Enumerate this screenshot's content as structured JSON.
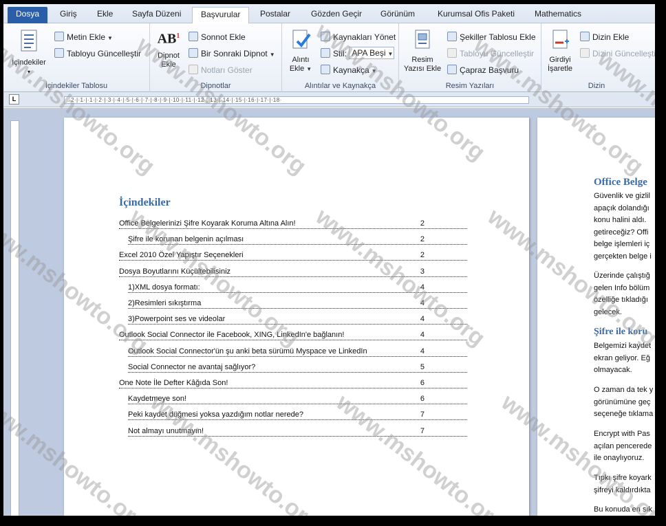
{
  "tabs": {
    "file": "Dosya",
    "items": [
      "Giriş",
      "Ekle",
      "Sayfa Düzeni",
      "Başvurular",
      "Postalar",
      "Gözden Geçir",
      "Görünüm",
      "Kurumsal Ofis Paketi",
      "Mathematics"
    ],
    "active": "Başvurular"
  },
  "ribbon": {
    "toc_group": {
      "label": "İçindekiler Tablosu",
      "toc_button": "İçindekiler",
      "add_text": "Metin Ekle",
      "update_table": "Tabloyu Güncelleştir"
    },
    "footnotes_group": {
      "label": "Dipnotlar",
      "insert_footnote_1": "Dipnot",
      "insert_footnote_2": "Ekle",
      "insert_endnote": "Sonnot Ekle",
      "next_footnote": "Bir Sonraki Dipnot",
      "show_notes": "Notları Göster"
    },
    "citations_group": {
      "label": "Alıntılar ve Kaynakça",
      "insert_citation_1": "Alıntı",
      "insert_citation_2": "Ekle",
      "manage_sources": "Kaynakları Yönet",
      "style_label": "Stil:",
      "style_value": "APA Beşi",
      "bibliography": "Kaynakça"
    },
    "captions_group": {
      "label": "Resim Yazıları",
      "insert_caption_1": "Resim",
      "insert_caption_2": "Yazısı Ekle",
      "insert_tof": "Şekiller Tablosu Ekle",
      "update_table": "Tabloyu Güncelleştir",
      "cross_ref": "Çapraz Başvuru"
    },
    "index_group": {
      "label": "Dizin",
      "mark_entry_1": "Girdiyi",
      "mark_entry_2": "İşaretle",
      "insert_index": "Dizin Ekle",
      "update_index": "Dizini Güncelleştir"
    }
  },
  "ruler": {
    "corner": "L",
    "text": "·2·|·1·|·1·|·2·|·3·|·4·|·5·|·6·|·7·|·8·|·9·|·10·|·11·|·12·|·13·|·14·|·15·|·16·|·17·|·18·"
  },
  "toc": {
    "title": "İçindekiler",
    "entries": [
      {
        "text": "Office Belgelerinizi Şifre Koyarak Koruma Altına Alın!",
        "page": "2",
        "level": 1
      },
      {
        "text": "Şifre ile korunan belgenin açılması",
        "page": "2",
        "level": 2
      },
      {
        "text": "Excel 2010 Özel Yapıştır Seçenekleri",
        "page": "2",
        "level": 1
      },
      {
        "text": "Dosya Boyutlarını Küçültebilisiniz",
        "page": "3",
        "level": 1
      },
      {
        "text": "1)XML dosya formatı:",
        "page": "4",
        "level": 2
      },
      {
        "text": "2)Resimleri sıkıştırma",
        "page": "4",
        "level": 2
      },
      {
        "text": "3)Powerpoint ses ve videolar",
        "page": "4",
        "level": 2
      },
      {
        "text": "Outlook Social Connector ile Facebook, XING, LinkedIn'e bağlanın!",
        "page": "4",
        "level": 1
      },
      {
        "text": "Outlook Social Connector'ün şu anki beta sürümü Myspace ve LinkedIn",
        "page": "4",
        "level": 2
      },
      {
        "text": "Social Connector ne avantaj sağlıyor?",
        "page": "5",
        "level": 2
      },
      {
        "text": "One Note İle Defter Kâğıda Son!",
        "page": "6",
        "level": 1
      },
      {
        "text": "Kaydetmeye son!",
        "page": "6",
        "level": 2
      },
      {
        "text": "Peki kaydet düğmesi yoksa yazdığım notlar nerede?",
        "page": "7",
        "level": 2
      },
      {
        "text": "Not almayı unutmayın!",
        "page": "7",
        "level": 2
      }
    ]
  },
  "page2": {
    "heading1": "Office Belge",
    "para1": [
      "Güvenlik ve gizlil",
      "apaçık dolandığı",
      "konu halini aldı.",
      "getireceğiz? Offi",
      "belge işlemleri iç",
      "gerçekten belge i"
    ],
    "para2": [
      "Üzerinde çalıştığ",
      "gelen Info bölüm",
      "özelliğe tıkladığı",
      "gelecek."
    ],
    "heading2": "Şifre ile koru",
    "para3": [
      "Belgemizi kaydet",
      "ekran geliyor. Eğ",
      "olmayacak."
    ],
    "para4": [
      "O zaman da tek y",
      "görünümüne geç",
      "seçeneğe tıklama"
    ],
    "para5": [
      " Encrypt with Pas",
      "açılan pencerede",
      "ile onaylıyoruz."
    ],
    "para6": [
      "Tıpkı şifre koyark",
      "şifreyi kaldırdıkta"
    ],
    "para7": [
      "Bu konuda  en sık"
    ]
  },
  "watermark": "www.mshowto.org"
}
